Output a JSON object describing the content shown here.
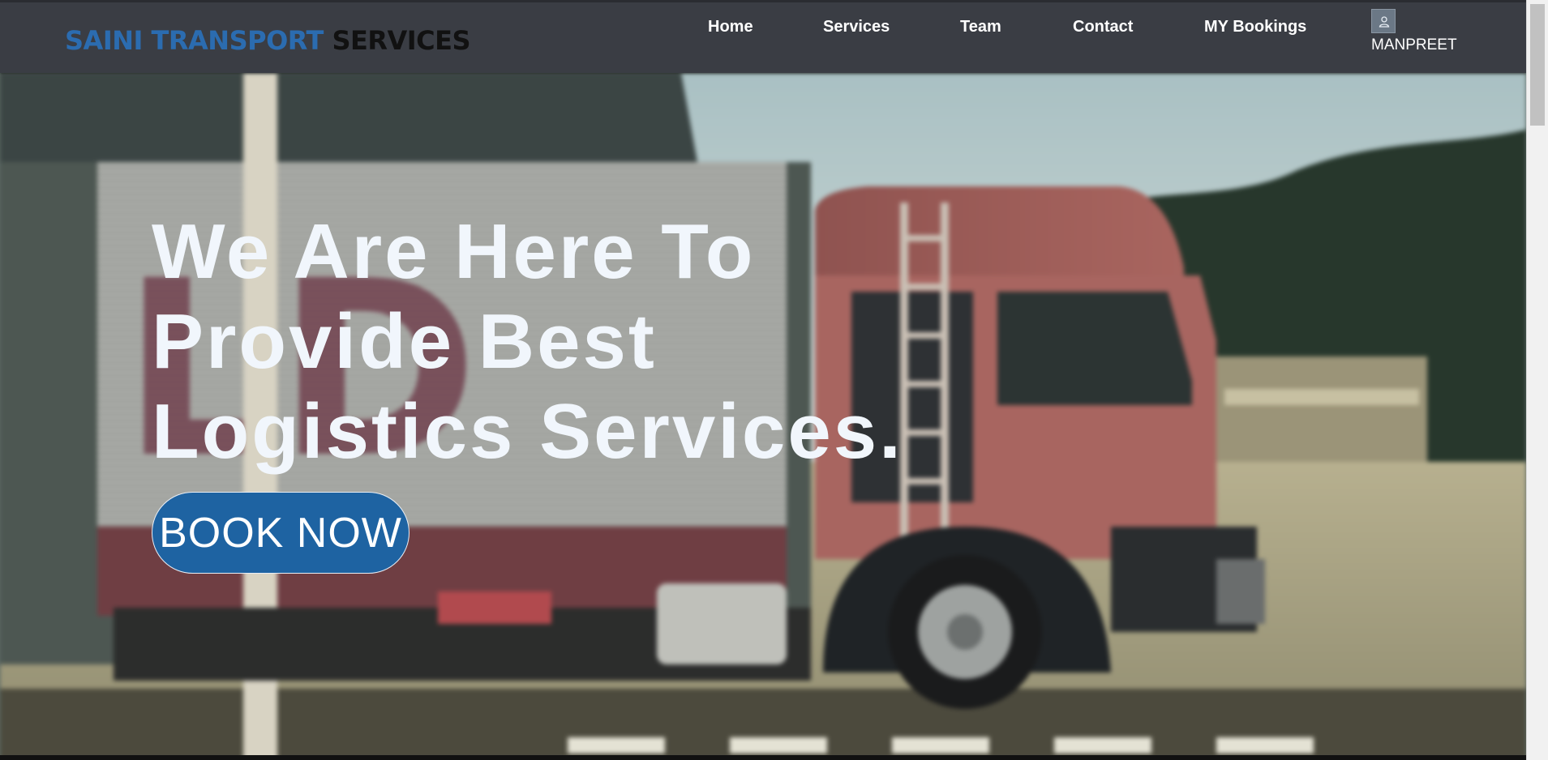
{
  "brand": {
    "part1": "SAINI TRANSPORT",
    "part2": "SERVICES"
  },
  "nav": {
    "home": "Home",
    "services": "Services",
    "team": "Team",
    "contact": "Contact",
    "bookings": "MY Bookings"
  },
  "user": {
    "name": "MANPREET",
    "icon": "user-icon"
  },
  "hero": {
    "line1": "We Are Here To",
    "line2": "Provide Best",
    "line3": "Logistics Services.",
    "cta": "BOOK NOW",
    "background": "blurred red truck photo"
  },
  "colors": {
    "navbar": "#3a3d44",
    "brand_blue": "#2b6cb0",
    "cta": "#1e63a2"
  }
}
